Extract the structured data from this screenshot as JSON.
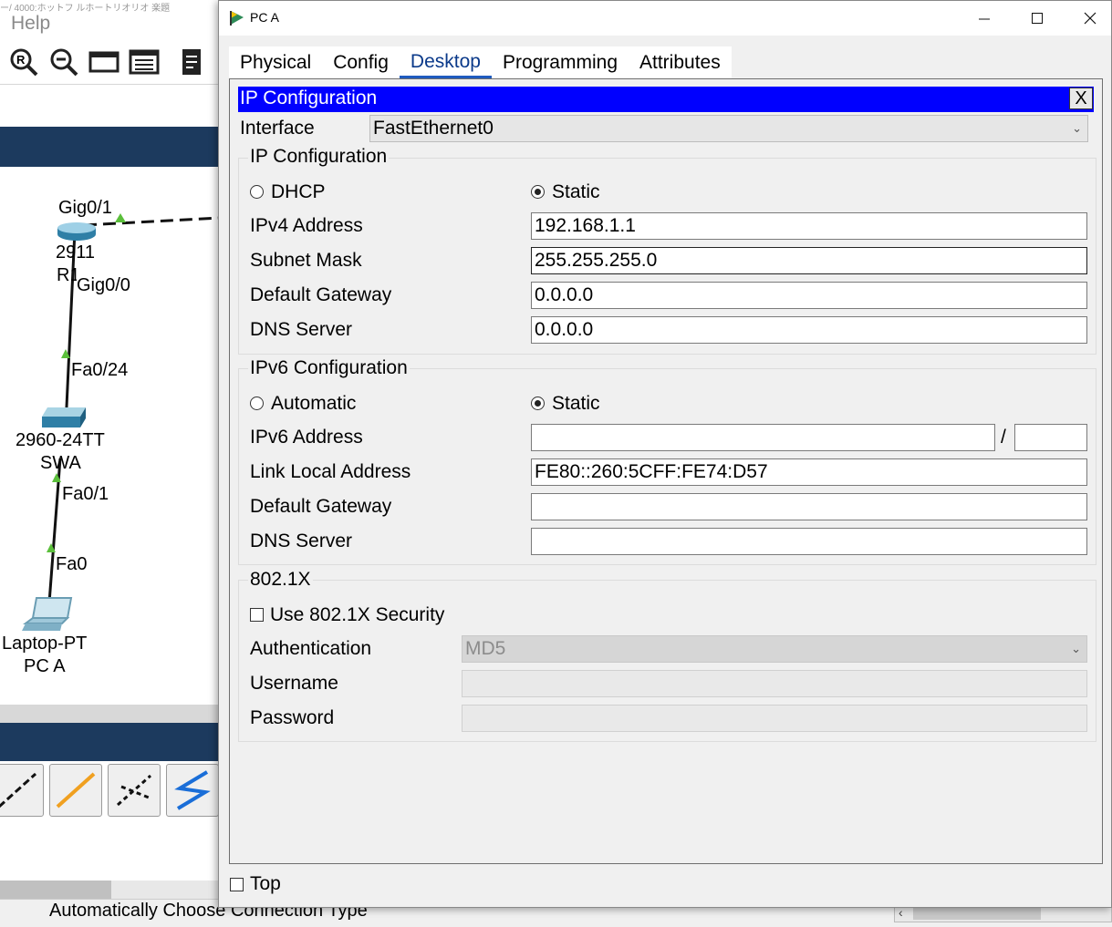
{
  "background": {
    "garbled_title": "ー/ 4000:ホットフ ルホートリオリオ 楽題",
    "menu_help": "Help",
    "toolbar_icons": [
      "zoom-in-icon",
      "zoom-out-icon",
      "window-icon",
      "list-view-icon",
      "notes-icon"
    ],
    "devices": {
      "router_port_top": "Gig0/1",
      "router_model": "2911",
      "router_name": "R1",
      "router_port_bottom": "Gig0/0",
      "switch_port_top": "Fa0/24",
      "switch_model": "2960-24TT",
      "switch_name": "SWA",
      "switch_port_bottom": "Fa0/1",
      "laptop_port": "Fa0",
      "laptop_model": "Laptop-PT",
      "laptop_name": "PC A"
    },
    "link_tools": [
      "console-link-icon",
      "copper-straight-icon",
      "copper-cross-icon",
      "serial-link-icon"
    ],
    "status_text": "Automatically Choose Connection Type"
  },
  "window": {
    "title": "PC A",
    "tabs": [
      "Physical",
      "Config",
      "Desktop",
      "Programming",
      "Attributes"
    ],
    "active_tab": "Desktop",
    "top_checkbox_label": "Top",
    "top_checked": false
  },
  "ip_config": {
    "header_title": "IP Configuration",
    "close_label": "X",
    "interface_label": "Interface",
    "interface_value": "FastEthernet0",
    "ipv4": {
      "section_title": "IP Configuration",
      "dhcp_label": "DHCP",
      "static_label": "Static",
      "mode": "Static",
      "address_label": "IPv4 Address",
      "address_value": "192.168.1.1",
      "mask_label": "Subnet Mask",
      "mask_value": "255.255.255.0",
      "gateway_label": "Default Gateway",
      "gateway_value": "0.0.0.0",
      "dns_label": "DNS Server",
      "dns_value": "0.0.0.0"
    },
    "ipv6": {
      "section_title": "IPv6 Configuration",
      "auto_label": "Automatic",
      "static_label": "Static",
      "mode": "Static",
      "address_label": "IPv6 Address",
      "address_value": "",
      "prefix_separator": "/",
      "prefix_value": "",
      "link_local_label": "Link Local Address",
      "link_local_value": "FE80::260:5CFF:FE74:D57",
      "gateway_label": "Default Gateway",
      "gateway_value": "",
      "dns_label": "DNS Server",
      "dns_value": ""
    },
    "dot1x": {
      "section_title": "802.1X",
      "use_label": "Use 802.1X Security",
      "use_checked": false,
      "auth_label": "Authentication",
      "auth_value": "MD5",
      "username_label": "Username",
      "username_value": "",
      "password_label": "Password",
      "password_value": ""
    }
  },
  "colors": {
    "header_blue": "#0000ff",
    "band_navy": "#1c3a5e",
    "link_green": "#5bbf3b",
    "active_tab_underline": "#1f5bbf"
  }
}
